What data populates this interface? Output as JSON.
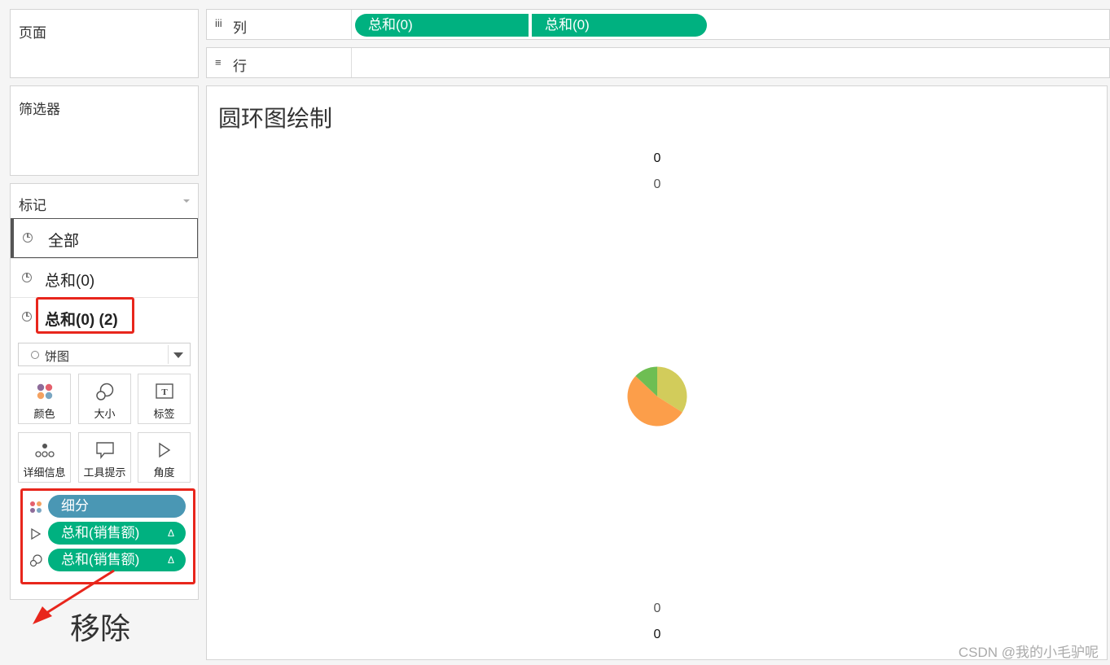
{
  "pages_card": {
    "title": "页面"
  },
  "filters_card": {
    "title": "筛选器"
  },
  "marks_card": {
    "title": "标记",
    "rows": [
      {
        "label": "全部"
      },
      {
        "label": "总和(0)"
      },
      {
        "label": "总和(0) (2)"
      }
    ],
    "mark_type": "饼图",
    "tiles": [
      {
        "label": "颜色",
        "icon": "color-icon"
      },
      {
        "label": "大小",
        "icon": "size-icon"
      },
      {
        "label": "标签",
        "icon": "label-icon"
      },
      {
        "label": "详细信息",
        "icon": "detail-icon"
      },
      {
        "label": "工具提示",
        "icon": "tooltip-icon"
      },
      {
        "label": "角度",
        "icon": "angle-icon"
      }
    ],
    "pills": [
      {
        "label": "细分",
        "delta": "",
        "icon": "color-icon",
        "color": "#4a97b4"
      },
      {
        "label": "总和(销售额)",
        "delta": "Δ",
        "icon": "angle-icon",
        "color": "#00b180"
      },
      {
        "label": "总和(销售额)",
        "delta": "Δ",
        "icon": "size-icon",
        "color": "#00b180"
      }
    ]
  },
  "shelves": {
    "columns": {
      "icon": "iii",
      "label": "列",
      "pills": [
        "总和(0)",
        "总和(0)"
      ]
    },
    "rows": {
      "icon": "≡",
      "label": "行"
    }
  },
  "view": {
    "title": "圆环图绘制",
    "top_labels": [
      "0",
      "0"
    ],
    "bottom_labels": [
      "0",
      "0"
    ],
    "pie_slices": [
      {
        "value": 34,
        "color": "#d2cc5b"
      },
      {
        "value": 53,
        "color": "#fc9e4a"
      },
      {
        "value": 13,
        "color": "#6ebe53"
      }
    ]
  },
  "annotation": {
    "text": "移除",
    "color": "#e8261c"
  },
  "watermark": "CSDN @我的小毛驴呢"
}
